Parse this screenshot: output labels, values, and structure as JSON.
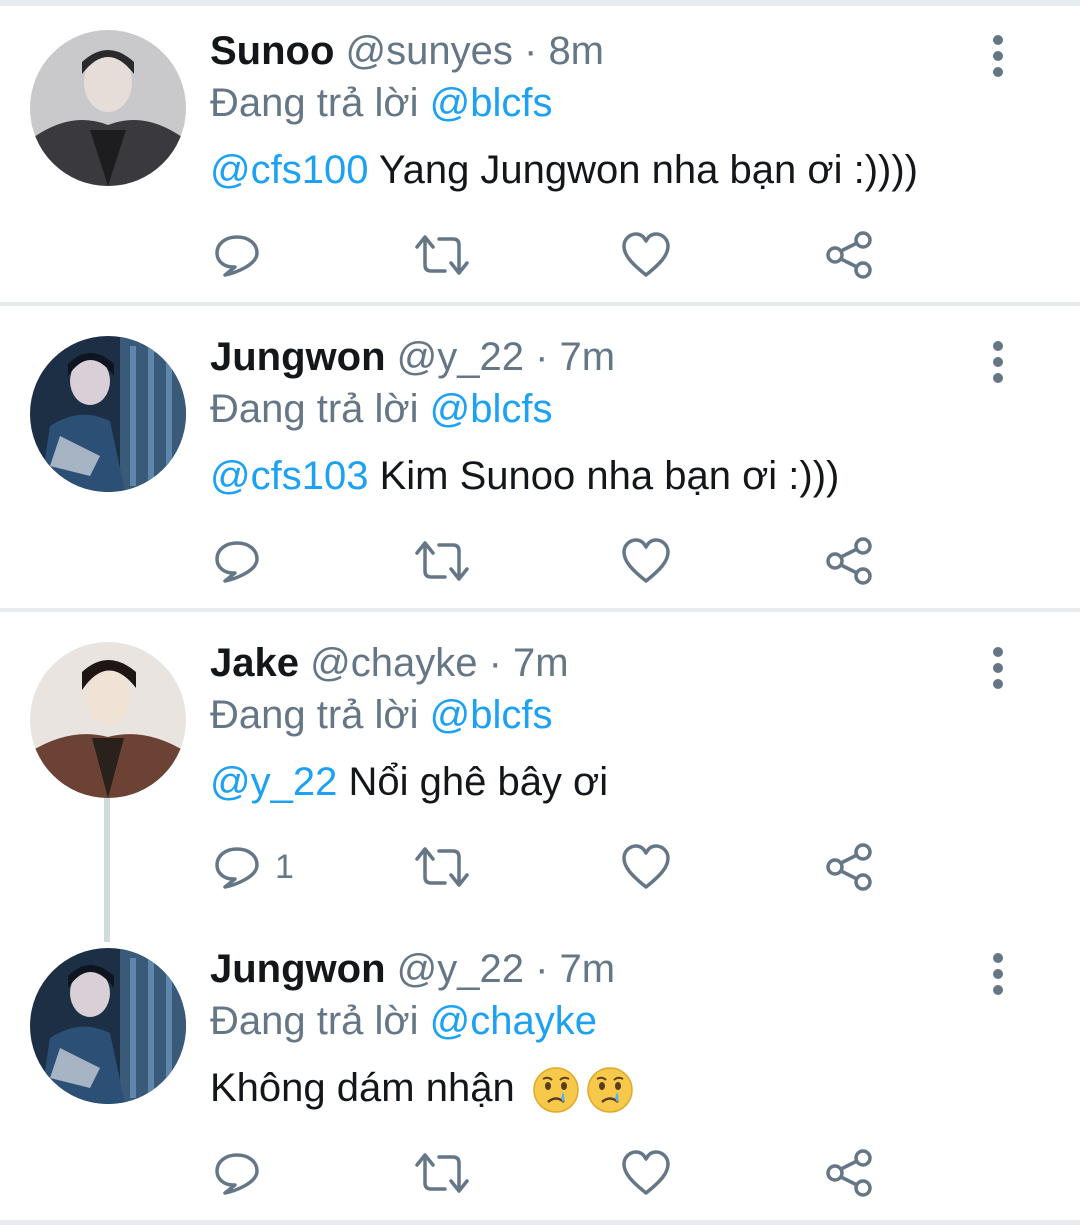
{
  "colors": {
    "link": "#1da1f2",
    "muted": "#657786",
    "text": "#14171a",
    "divider": "#e6ecf0"
  },
  "tweets": [
    {
      "name": "Sunoo",
      "handle": "@sunyes",
      "sep": " · ",
      "time": "8m",
      "replying_prefix": "Đang trả lời ",
      "replying_to": "@blcfs",
      "mention": "@cfs100",
      "text": " Yang Jungwon nha bạn ơi :))))",
      "reply_count": ""
    },
    {
      "name": "Jungwon",
      "handle": "@y_22",
      "sep": " · ",
      "time": "7m",
      "replying_prefix": "Đang trả lời ",
      "replying_to": "@blcfs",
      "mention": "@cfs103",
      "text": " Kim Sunoo nha bạn ơi :)))",
      "reply_count": ""
    },
    {
      "name": "Jake",
      "handle": "@chayke",
      "sep": " · ",
      "time": "7m",
      "replying_prefix": "Đang trả lời ",
      "replying_to": "@blcfs",
      "mention": "@y_22",
      "text": " Nổi ghê bây ơi",
      "reply_count": "1"
    },
    {
      "name": "Jungwon",
      "handle": "@y_22",
      "sep": " · ",
      "time": "7m",
      "replying_prefix": "Đang trả lời ",
      "replying_to": "@chayke",
      "mention": "",
      "text": "Không dám nhận",
      "emojis": [
        "crying-face-emoji",
        "crying-face-emoji"
      ],
      "reply_count": ""
    }
  ],
  "icons": [
    "reply-icon",
    "retweet-icon",
    "like-icon",
    "share-icon",
    "more-options-icon"
  ]
}
